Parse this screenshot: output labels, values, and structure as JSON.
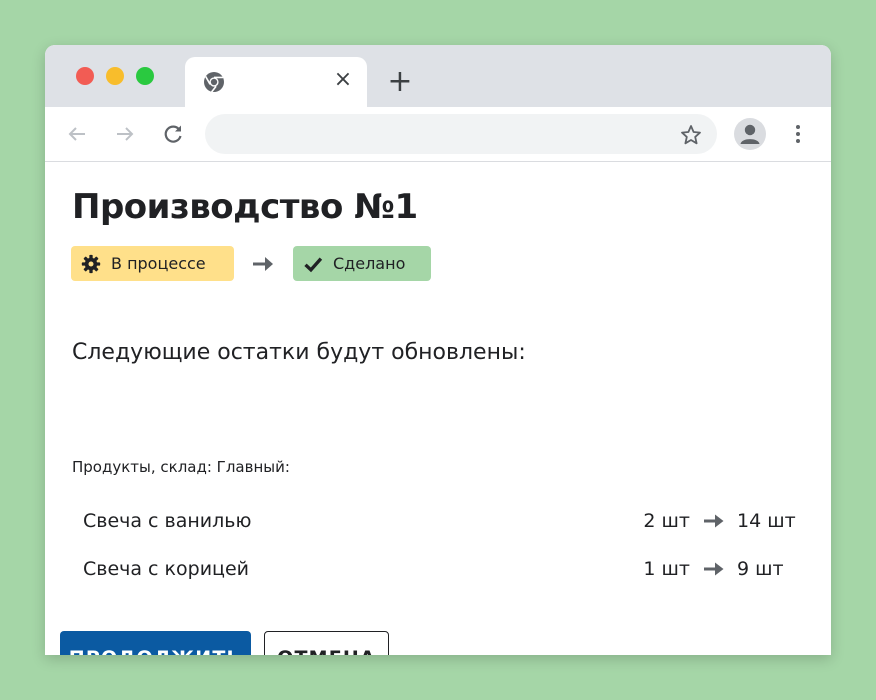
{
  "browser": {
    "tab_close_glyph": "×",
    "new_tab_glyph": "+",
    "address_value": "",
    "address_placeholder": "",
    "icons": [
      "chrome-icon",
      "back-arrow-icon",
      "forward-arrow-icon",
      "reload-icon",
      "star-icon",
      "profile-icon",
      "more-vert-icon"
    ]
  },
  "page": {
    "title": "Производство №1",
    "status_flow": {
      "from": {
        "label": "В процессе",
        "icon": "gear-icon",
        "color": "#ffe08a"
      },
      "to": {
        "label": "Сделано",
        "icon": "check-icon",
        "color": "#a5d6a7"
      }
    },
    "subtitle": "Следующие остатки будут обновлены:",
    "section_label": "Продукты, склад: Главный:",
    "items": [
      {
        "name": "Свеча с ванилью",
        "from": "2 шт",
        "to": "14 шт"
      },
      {
        "name": "Свеча с корицей",
        "from": "1 шт",
        "to": "9 шт"
      }
    ],
    "buttons": {
      "continue": "ПРОДОЛЖИТЬ",
      "cancel": "ОТМЕНА"
    }
  },
  "colors": {
    "background": "#a5d6a7",
    "primary": "#0b5aa2",
    "in_progress": "#ffe08a",
    "done": "#a5d6a7"
  }
}
